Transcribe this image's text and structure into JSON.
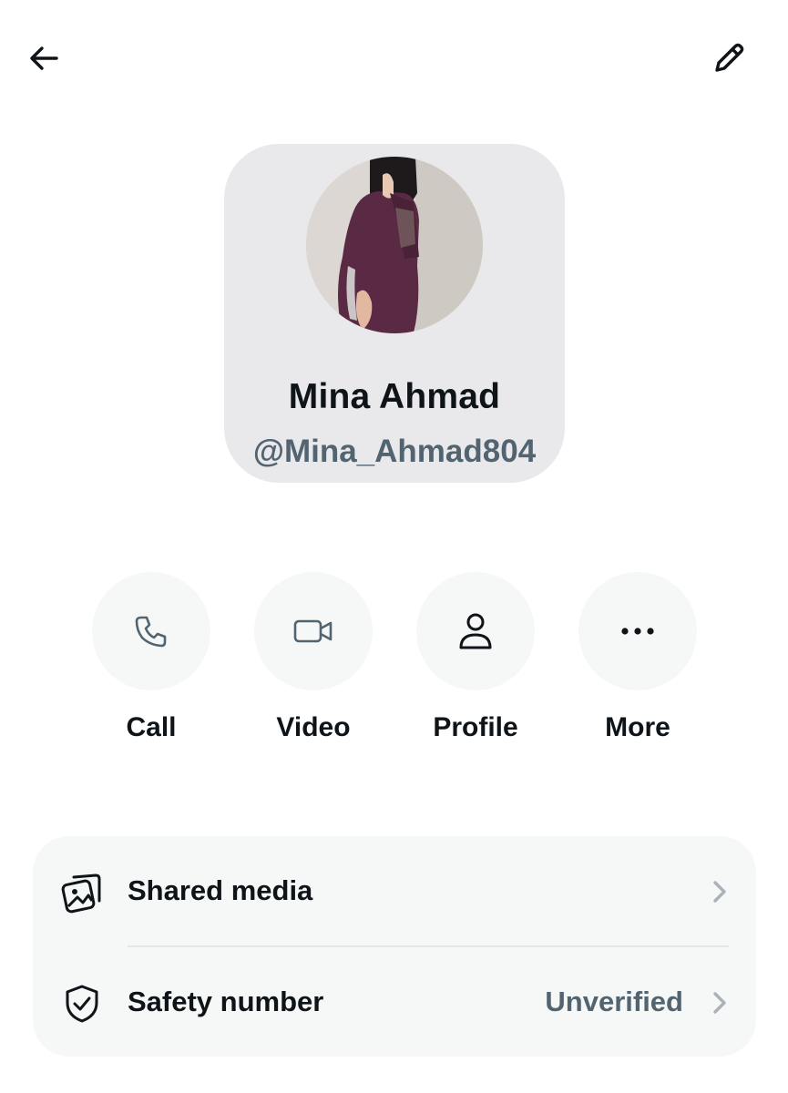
{
  "header": {
    "back_icon": "back-arrow-icon",
    "edit_icon": "pencil-icon"
  },
  "profile": {
    "display_name": "Mina Ahmad",
    "handle": "@Mina_Ahmad804",
    "avatar_icon": "profile-photo"
  },
  "actions": [
    {
      "label": "Call",
      "icon": "phone-icon"
    },
    {
      "label": "Video",
      "icon": "video-camera-icon"
    },
    {
      "label": "Profile",
      "icon": "person-icon"
    },
    {
      "label": "More",
      "icon": "more-dots-icon"
    }
  ],
  "list": {
    "shared_media": {
      "label": "Shared media",
      "icon": "media-gallery-icon"
    },
    "safety_number": {
      "label": "Safety number",
      "value": "Unverified",
      "icon": "shield-check-icon"
    }
  },
  "colors": {
    "text_primary": "#0f1419",
    "text_secondary": "#536471",
    "card_background": "#e9e9ec",
    "action_background": "#f5f8f7"
  }
}
